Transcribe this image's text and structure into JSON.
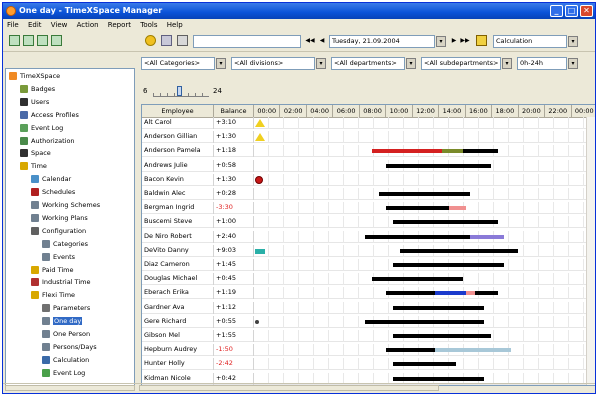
{
  "window": {
    "title": "One day - TimeXSpace Manager"
  },
  "menu": [
    "File",
    "Edit",
    "View",
    "Action",
    "Report",
    "Tools",
    "Help"
  ],
  "toolbar": {
    "date_value": "Tuesday, 21.09.2004",
    "mode_value": "Calculation"
  },
  "filters": {
    "categories": "<All Categories>",
    "divisions": "<All divisions>",
    "departments": "<All departments>",
    "subdepartments": "<All subdepartments>",
    "range": "0h-24h"
  },
  "zoom": {
    "min_label": "6",
    "max_label": "24"
  },
  "tree": [
    {
      "label": "TimeXSpace",
      "icon": "timexspace-icon",
      "color": "#f08a24",
      "indent": 0
    },
    {
      "label": "Badges",
      "icon": "badges-icon",
      "color": "#7a9a3a",
      "indent": 1
    },
    {
      "label": "Users",
      "icon": "users-icon",
      "color": "#303030",
      "indent": 1
    },
    {
      "label": "Access Profiles",
      "icon": "access-profiles-icon",
      "color": "#4a6aa8",
      "indent": 1
    },
    {
      "label": "Event Log",
      "icon": "event-log-icon",
      "color": "#5aa05a",
      "indent": 1
    },
    {
      "label": "Authorization",
      "icon": "authorization-icon",
      "color": "#4a8a4a",
      "indent": 1
    },
    {
      "label": "Space",
      "icon": "space-icon",
      "color": "#303030",
      "indent": 1
    },
    {
      "label": "Time",
      "icon": "time-icon",
      "color": "#d8a800",
      "indent": 1
    },
    {
      "label": "Calendar",
      "icon": "calendar-icon",
      "color": "#4a90c8",
      "indent": 2
    },
    {
      "label": "Schedules",
      "icon": "schedules-icon",
      "color": "#b02020",
      "indent": 2
    },
    {
      "label": "Working Schemes",
      "icon": "working-schemes-icon",
      "color": "#708090",
      "indent": 2
    },
    {
      "label": "Working Plans",
      "icon": "working-plans-icon",
      "color": "#708090",
      "indent": 2
    },
    {
      "label": "Configuration",
      "icon": "configuration-icon",
      "color": "#606060",
      "indent": 2
    },
    {
      "label": "Categories",
      "icon": "categories-icon",
      "color": "#708090",
      "indent": 3
    },
    {
      "label": "Events",
      "icon": "events-icon",
      "color": "#708090",
      "indent": 3
    },
    {
      "label": "Paid Time",
      "icon": "paid-time-icon",
      "color": "#d8a800",
      "indent": 2
    },
    {
      "label": "Industrial Time",
      "icon": "industrial-time-icon",
      "color": "#b03030",
      "indent": 2
    },
    {
      "label": "Flexi Time",
      "icon": "flexi-time-icon",
      "color": "#d8a800",
      "indent": 2
    },
    {
      "label": "Parameters",
      "icon": "parameters-icon",
      "color": "#707070",
      "indent": 3
    },
    {
      "label": "One day",
      "icon": "one-day-icon",
      "color": "#708090",
      "indent": 3,
      "selected": true
    },
    {
      "label": "One Person",
      "icon": "one-person-icon",
      "color": "#708090",
      "indent": 3
    },
    {
      "label": "Persons/Days",
      "icon": "persons-days-icon",
      "color": "#708090",
      "indent": 3
    },
    {
      "label": "Calculation",
      "icon": "calculation-icon",
      "color": "#3a6aa8",
      "indent": 3
    },
    {
      "label": "Event Log",
      "icon": "flexi-event-log-icon",
      "color": "#4aa04a",
      "indent": 3
    }
  ],
  "grid": {
    "columns": {
      "employee": "Employee",
      "balance": "Balance"
    },
    "hours": [
      "00:00",
      "02:00",
      "04:00",
      "06:00",
      "08:00",
      "10:00",
      "12:00",
      "14:00",
      "16:00",
      "18:00",
      "20:00",
      "22:00",
      "00:00"
    ],
    "rows": [
      {
        "name": "Alt Carol",
        "balance": "+3:10",
        "negative": false,
        "marker": "warning-icon",
        "bars": []
      },
      {
        "name": "Anderson Gillian",
        "balance": "+1:30",
        "negative": false,
        "marker": "warning-icon",
        "bars": []
      },
      {
        "name": "Anderson Pamela",
        "balance": "+1:18",
        "negative": false,
        "marker": null,
        "bars": [
          {
            "start": 8.5,
            "end": 13.5,
            "color": "#d42020"
          },
          {
            "start": 13.5,
            "end": 15.0,
            "color": "#7a8a2a"
          },
          {
            "start": 15.0,
            "end": 17.5,
            "color": "#000000"
          }
        ]
      },
      {
        "name": "Andrews Julie",
        "balance": "+0:58",
        "negative": false,
        "marker": null,
        "bars": [
          {
            "start": 9.5,
            "end": 17.0,
            "color": "#000000"
          }
        ]
      },
      {
        "name": "Bacon Kevin",
        "balance": "+1:30",
        "negative": false,
        "marker": "stop-icon",
        "bars": []
      },
      {
        "name": "Baldwin Alec",
        "balance": "+0:28",
        "negative": false,
        "marker": null,
        "bars": [
          {
            "start": 9.0,
            "end": 15.5,
            "color": "#000000"
          }
        ]
      },
      {
        "name": "Bergman Ingrid",
        "balance": "-3:30",
        "negative": true,
        "marker": null,
        "bars": [
          {
            "start": 9.5,
            "end": 14.0,
            "color": "#000000"
          },
          {
            "start": 14.0,
            "end": 15.2,
            "color": "#f09090"
          }
        ]
      },
      {
        "name": "Buscemi Steve",
        "balance": "+1:00",
        "negative": false,
        "marker": null,
        "bars": [
          {
            "start": 10.0,
            "end": 17.5,
            "color": "#000000"
          }
        ]
      },
      {
        "name": "De Niro Robert",
        "balance": "+2:40",
        "negative": false,
        "marker": null,
        "bars": [
          {
            "start": 8.0,
            "end": 15.5,
            "color": "#000000"
          },
          {
            "start": 15.5,
            "end": 18.0,
            "color": "#8a7ad8"
          }
        ]
      },
      {
        "name": "DeVito Danny",
        "balance": "+9:03",
        "negative": false,
        "marker": "arrow-icon",
        "bars": [
          {
            "start": 10.5,
            "end": 19.0,
            "color": "#000000"
          }
        ]
      },
      {
        "name": "Diaz Cameron",
        "balance": "+1:45",
        "negative": false,
        "marker": null,
        "bars": [
          {
            "start": 10.0,
            "end": 18.0,
            "color": "#000000"
          }
        ]
      },
      {
        "name": "Douglas Michael",
        "balance": "+0:45",
        "negative": false,
        "marker": null,
        "bars": [
          {
            "start": 8.5,
            "end": 15.0,
            "color": "#000000"
          }
        ]
      },
      {
        "name": "Eberach Erika",
        "balance": "+1:19",
        "negative": false,
        "marker": null,
        "bars": [
          {
            "start": 9.5,
            "end": 13.0,
            "color": "#000000"
          },
          {
            "start": 13.0,
            "end": 15.2,
            "color": "#1a3acc"
          },
          {
            "start": 15.2,
            "end": 15.9,
            "color": "#f09090"
          },
          {
            "start": 15.9,
            "end": 17.5,
            "color": "#000000"
          }
        ]
      },
      {
        "name": "Gardner Ava",
        "balance": "+1:12",
        "negative": false,
        "marker": null,
        "bars": [
          {
            "start": 10.0,
            "end": 16.5,
            "color": "#000000"
          }
        ]
      },
      {
        "name": "Gere Richard",
        "balance": "+0:55",
        "negative": false,
        "marker": "dot-icon",
        "bars": [
          {
            "start": 8.0,
            "end": 16.5,
            "color": "#000000"
          }
        ]
      },
      {
        "name": "Gibson Mel",
        "balance": "+1:55",
        "negative": false,
        "marker": null,
        "bars": [
          {
            "start": 10.0,
            "end": 17.0,
            "color": "#000000"
          }
        ]
      },
      {
        "name": "Hepburn Audrey",
        "balance": "-1:50",
        "negative": true,
        "marker": null,
        "bars": [
          {
            "start": 9.5,
            "end": 13.0,
            "color": "#000000"
          },
          {
            "start": 13.0,
            "end": 18.5,
            "color": "#a8c8d8"
          }
        ]
      },
      {
        "name": "Hunter Holly",
        "balance": "-2:42",
        "negative": true,
        "marker": null,
        "bars": [
          {
            "start": 10.0,
            "end": 14.5,
            "color": "#000000"
          }
        ]
      },
      {
        "name": "Kidman Nicole",
        "balance": "+0:42",
        "negative": false,
        "marker": null,
        "bars": [
          {
            "start": 10.0,
            "end": 16.5,
            "color": "#000000"
          }
        ]
      }
    ]
  }
}
